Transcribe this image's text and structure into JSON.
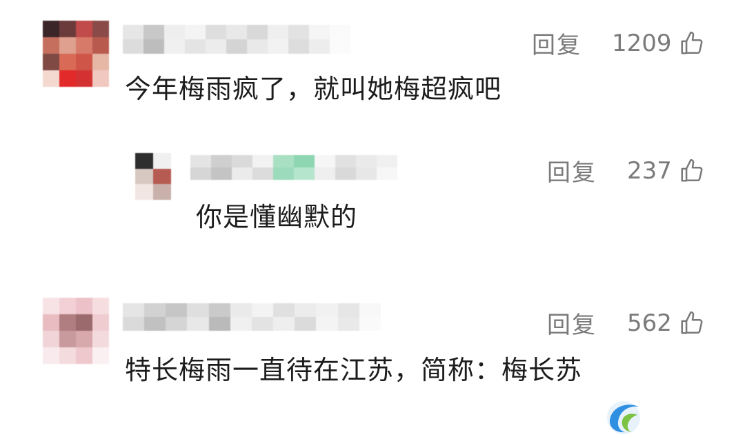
{
  "comments": [
    {
      "text": "今年梅雨疯了，就叫她梅超疯吧",
      "reply_label": "回复",
      "likes": "1209",
      "like_icon": "thumbs-up-icon"
    },
    {
      "text": "你是懂幽默的",
      "reply_label": "回复",
      "likes": "237",
      "like_icon": "thumbs-up-icon"
    },
    {
      "text": "特长梅雨一直待在江苏，简称：梅长苏",
      "reply_label": "回复",
      "likes": "562",
      "like_icon": "thumbs-up-icon"
    }
  ],
  "watermark": {
    "icon": "brand-logo-icon"
  },
  "colors": {
    "text": "#1c1c1c",
    "meta": "#7a7a7a",
    "logo_blue": "#2f8fe0",
    "logo_green": "#7cc243"
  }
}
